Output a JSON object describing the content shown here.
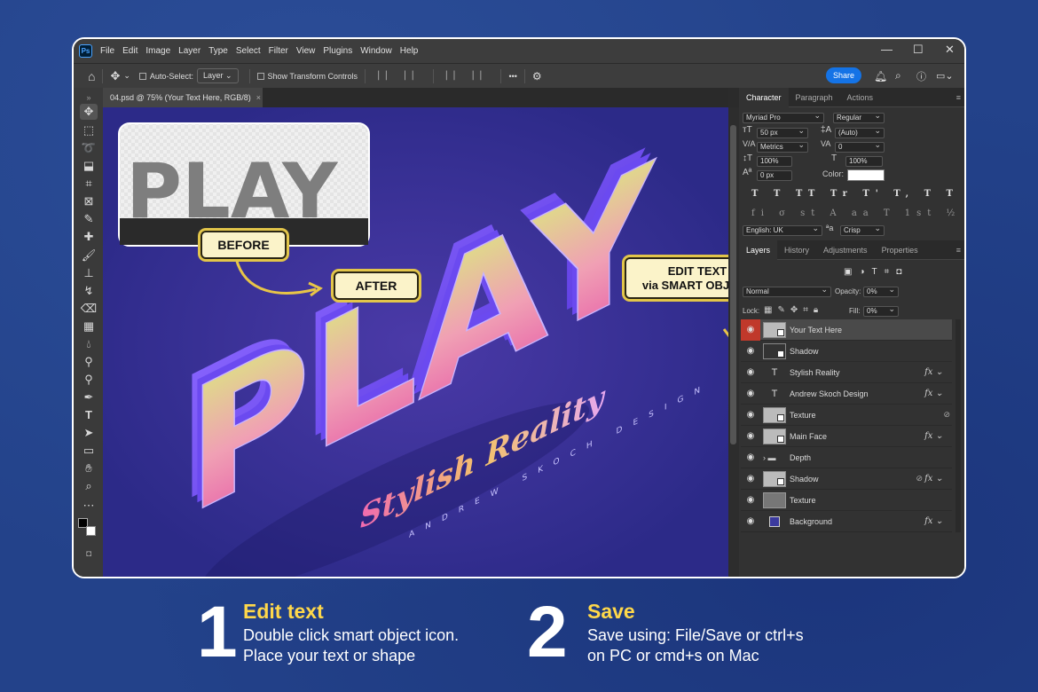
{
  "app": {
    "logo": "Ps",
    "menu": [
      "File",
      "Edit",
      "Image",
      "Layer",
      "Type",
      "Select",
      "Filter",
      "View",
      "Plugins",
      "Window",
      "Help"
    ],
    "window_controls": [
      "—",
      "☐",
      "✕"
    ]
  },
  "options_bar": {
    "auto_select_label": "Auto-Select:",
    "auto_select_value": "Layer",
    "show_transform_label": "Show Transform Controls",
    "more": "•••",
    "share_label": "Share"
  },
  "document_tab": {
    "title": "04.psd @ 75% (Your Text Here, RGB/8)",
    "close": "×"
  },
  "artwork": {
    "before_text": "PLAY",
    "main_text": "PLAY",
    "script_text": "Stylish Reality",
    "subtitle_text": "ANDREW SKOCH DESIGN"
  },
  "callouts": {
    "before": "BEFORE",
    "after": "AFTER",
    "edit_line1": "EDIT TEXT",
    "edit_line2": "via SMART OBJECT"
  },
  "character_panel": {
    "tabs": [
      "Character",
      "Paragraph",
      "Actions"
    ],
    "font_family": "Myriad Pro",
    "font_style": "Regular",
    "font_size": "50 px",
    "leading": "(Auto)",
    "kerning": "Metrics",
    "tracking": "0",
    "vertical_scale": "100%",
    "horizontal_scale": "100%",
    "baseline_shift": "0 px",
    "color_label": "Color:",
    "color_value": "#ffffff",
    "style_glyphs": "T T TT Tr T' T, T T",
    "opentype_glyphs": "fi σ st A aa T 1st ½",
    "language": "English: UK",
    "aa_label": "ªa",
    "antialias": "Crisp"
  },
  "layers_panel": {
    "tabs": [
      "Layers",
      "History",
      "Adjustments",
      "Properties"
    ],
    "blend_mode": "Normal",
    "opacity_label": "Opacity:",
    "opacity_value": "0%",
    "lock_label": "Lock:",
    "fill_label": "Fill:",
    "fill_value": "0%",
    "layers": [
      {
        "name": "Your Text Here",
        "kind": "smart",
        "fx": false,
        "selected": true
      },
      {
        "name": "Shadow",
        "kind": "smart-dark",
        "fx": false
      },
      {
        "name": "Stylish Reality",
        "kind": "text",
        "fx": true
      },
      {
        "name": "Andrew Skoch Design",
        "kind": "text",
        "fx": true
      },
      {
        "name": "Texture",
        "kind": "smart",
        "fx": false,
        "extra": "link"
      },
      {
        "name": "Main Face",
        "kind": "smart",
        "fx": true
      },
      {
        "name": "Depth",
        "kind": "group",
        "fx": false
      },
      {
        "name": "Shadow",
        "kind": "smart",
        "fx": true,
        "extra": "link"
      },
      {
        "name": "Texture",
        "kind": "gray",
        "fx": false
      },
      {
        "name": "Background",
        "kind": "color",
        "fx": true,
        "color": "#3b3a9e"
      }
    ]
  },
  "steps": [
    {
      "number": "1",
      "title": "Edit text",
      "line1": "Double click smart object icon.",
      "line2": "Place your text or shape"
    },
    {
      "number": "2",
      "title": "Save",
      "line1": "Save using: File/Save or ctrl+s",
      "line2": "on PC or cmd+s on Mac"
    }
  ]
}
